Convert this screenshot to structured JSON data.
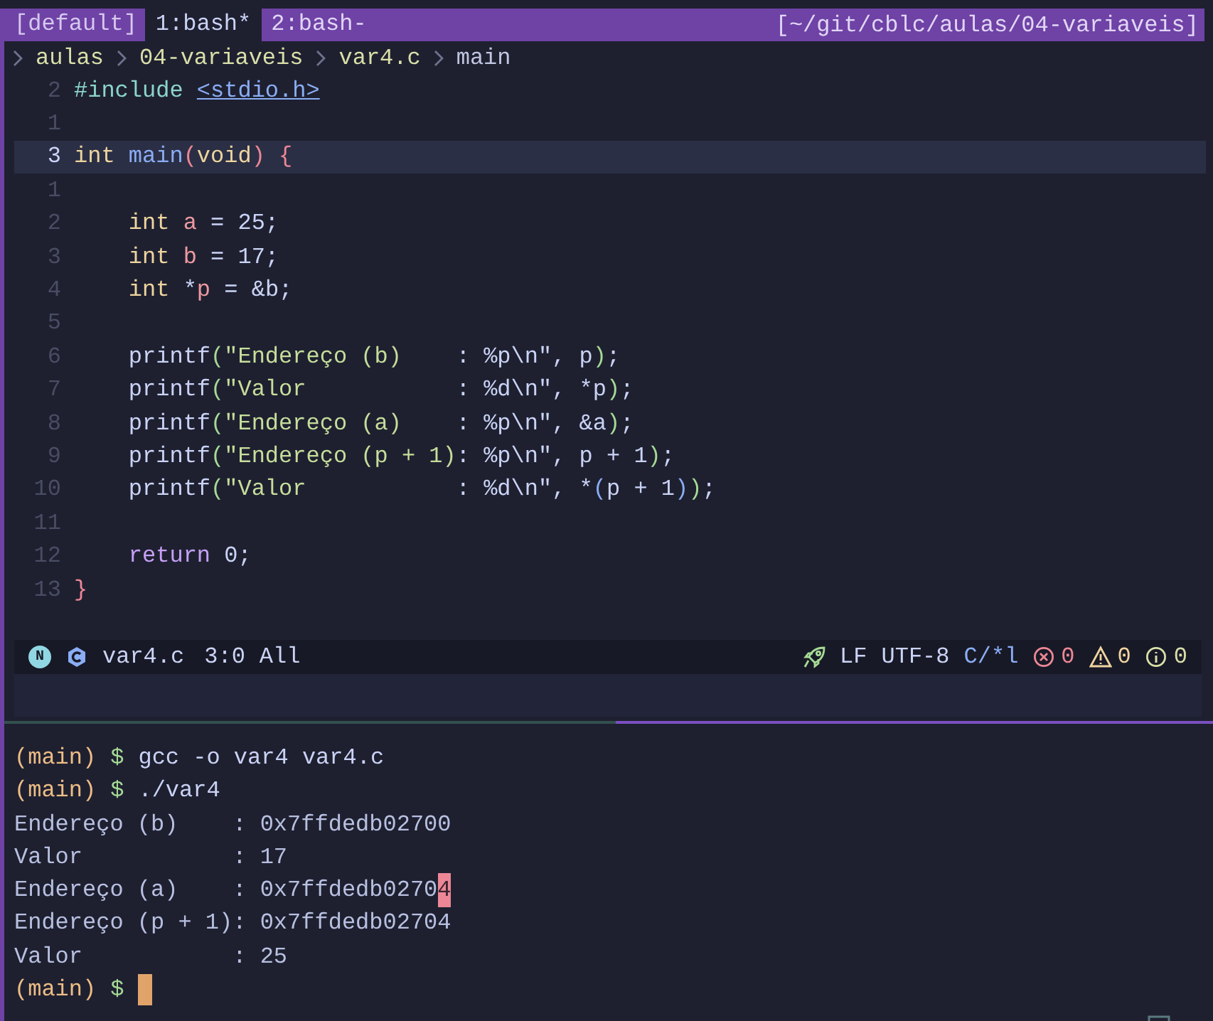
{
  "tmux": {
    "session": "[default]",
    "windows": [
      {
        "label": "1:bash*",
        "selected": true
      },
      {
        "label": "2:bash-",
        "selected": false
      }
    ],
    "path": "[~/git/cblc/aulas/04-variaveis]"
  },
  "breadcrumb": [
    "aulas",
    "04-variaveis",
    "var4.c",
    "main"
  ],
  "code": [
    {
      "number": "2",
      "current": false,
      "tokens": [
        {
          "text": "#include ",
          "kind": "preproc"
        },
        {
          "text": "<stdio.h>",
          "kind": "header"
        }
      ]
    },
    {
      "number": "1",
      "current": false
    },
    {
      "number": "3",
      "current": true,
      "tokens": [
        {
          "text": "int ",
          "kind": "keyword"
        },
        {
          "text": "main",
          "kind": "function"
        },
        {
          "text": "(",
          "kind": "bracket-red"
        },
        {
          "text": "void",
          "kind": "keyword"
        },
        {
          "text": ") {",
          "kind": "bracket-red"
        }
      ]
    },
    {
      "number": "1",
      "current": false
    },
    {
      "number": "2",
      "current": false,
      "tokens": [
        {
          "text": "    int ",
          "kind": "keyword"
        },
        {
          "text": "a",
          "kind": "variable"
        },
        {
          "text": " = 25;",
          "kind": "plain"
        }
      ]
    },
    {
      "number": "3",
      "current": false,
      "tokens": [
        {
          "text": "    int ",
          "kind": "keyword"
        },
        {
          "text": "b",
          "kind": "variable"
        },
        {
          "text": " = 17;",
          "kind": "plain"
        }
      ]
    },
    {
      "number": "4",
      "current": false,
      "tokens": [
        {
          "text": "    int",
          "kind": "keyword"
        },
        {
          "text": " *",
          "kind": "plain"
        },
        {
          "text": "p",
          "kind": "variable"
        },
        {
          "text": " = &b;",
          "kind": "plain"
        }
      ]
    },
    {
      "number": "5",
      "current": false
    },
    {
      "number": "6",
      "current": false,
      "tokens": [
        {
          "text": "    printf",
          "kind": "plain"
        },
        {
          "text": "(",
          "kind": "bracket-green"
        },
        {
          "text": "\"Endereço (b)    ",
          "kind": "string"
        },
        {
          "text": ": %p\\n\"",
          "kind": "format"
        },
        {
          "text": ", p",
          "kind": "plain"
        },
        {
          "text": ")",
          "kind": "bracket-green"
        },
        {
          "text": ";",
          "kind": "plain"
        }
      ]
    },
    {
      "number": "7",
      "current": false,
      "tokens": [
        {
          "text": "    printf",
          "kind": "plain"
        },
        {
          "text": "(",
          "kind": "bracket-green"
        },
        {
          "text": "\"Valor           ",
          "kind": "string"
        },
        {
          "text": ": %d\\n\"",
          "kind": "format"
        },
        {
          "text": ", *p",
          "kind": "plain"
        },
        {
          "text": ")",
          "kind": "bracket-green"
        },
        {
          "text": ";",
          "kind": "plain"
        }
      ]
    },
    {
      "number": "8",
      "current": false,
      "tokens": [
        {
          "text": "    printf",
          "kind": "plain"
        },
        {
          "text": "(",
          "kind": "bracket-green"
        },
        {
          "text": "\"Endereço (a)    ",
          "kind": "string"
        },
        {
          "text": ": %p\\n\"",
          "kind": "format"
        },
        {
          "text": ", &a",
          "kind": "plain"
        },
        {
          "text": ")",
          "kind": "bracket-green"
        },
        {
          "text": ";",
          "kind": "plain"
        }
      ]
    },
    {
      "number": "9",
      "current": false,
      "tokens": [
        {
          "text": "    printf",
          "kind": "plain"
        },
        {
          "text": "(",
          "kind": "bracket-green"
        },
        {
          "text": "\"Endereço (p + 1)",
          "kind": "string"
        },
        {
          "text": ": %p\\n\"",
          "kind": "format"
        },
        {
          "text": ", p + 1",
          "kind": "plain"
        },
        {
          "text": ")",
          "kind": "bracket-green"
        },
        {
          "text": ";",
          "kind": "plain"
        }
      ]
    },
    {
      "number": "10",
      "current": false,
      "tokens": [
        {
          "text": "    printf",
          "kind": "plain"
        },
        {
          "text": "(",
          "kind": "bracket-green"
        },
        {
          "text": "\"Valor           ",
          "kind": "string"
        },
        {
          "text": ": %d\\n\"",
          "kind": "format"
        },
        {
          "text": ", *",
          "kind": "plain"
        },
        {
          "text": "(",
          "kind": "bracket-blue"
        },
        {
          "text": "p + 1",
          "kind": "plain"
        },
        {
          "text": ")",
          "kind": "bracket-blue"
        },
        {
          "text": ")",
          "kind": "bracket-green"
        },
        {
          "text": ";",
          "kind": "plain"
        }
      ]
    },
    {
      "number": "11",
      "current": false
    },
    {
      "number": "12",
      "current": false,
      "tokens": [
        {
          "text": "    return ",
          "kind": "return"
        },
        {
          "text": "0;",
          "kind": "plain"
        }
      ]
    },
    {
      "number": "13",
      "current": false,
      "tokens": [
        {
          "text": "}",
          "kind": "bracket-red"
        }
      ]
    }
  ],
  "status_line": {
    "mode": "N",
    "filename": "var4.c",
    "position": "3:0",
    "scroll": "All",
    "eol": "LF",
    "encoding": "UTF-8",
    "filetype": "C/*l",
    "diagnostics": [
      {
        "kind": "error",
        "count": "0"
      },
      {
        "kind": "warning",
        "count": "0"
      },
      {
        "kind": "info",
        "count": "0"
      }
    ]
  },
  "terminal": [
    {
      "kind": "prompt",
      "branch": "(main)",
      "symbol": "$",
      "command": "gcc -o var4 var4.c",
      "cursor": false
    },
    {
      "kind": "prompt",
      "branch": "(main)",
      "symbol": "$",
      "command": "./var4",
      "cursor": false
    },
    {
      "kind": "output",
      "segments": [
        {
          "text": "Endereço (b)    : 0x7ffdedb02700",
          "highlighted": false
        }
      ]
    },
    {
      "kind": "output",
      "segments": [
        {
          "text": "Valor           : 17",
          "highlighted": false
        }
      ]
    },
    {
      "kind": "output",
      "segments": [
        {
          "text": "Endereço (a)    : 0x7ffdedb0270",
          "highlighted": false
        },
        {
          "text": "4",
          "highlighted": true
        }
      ]
    },
    {
      "kind": "output",
      "segments": [
        {
          "text": "Endereço (p + 1): 0x7ffdedb02704",
          "highlighted": false
        }
      ]
    },
    {
      "kind": "output",
      "segments": [
        {
          "text": "Valor           : 25",
          "highlighted": false
        }
      ]
    },
    {
      "kind": "prompt",
      "branch": "(main)",
      "symbol": "$",
      "cursor": true
    }
  ]
}
